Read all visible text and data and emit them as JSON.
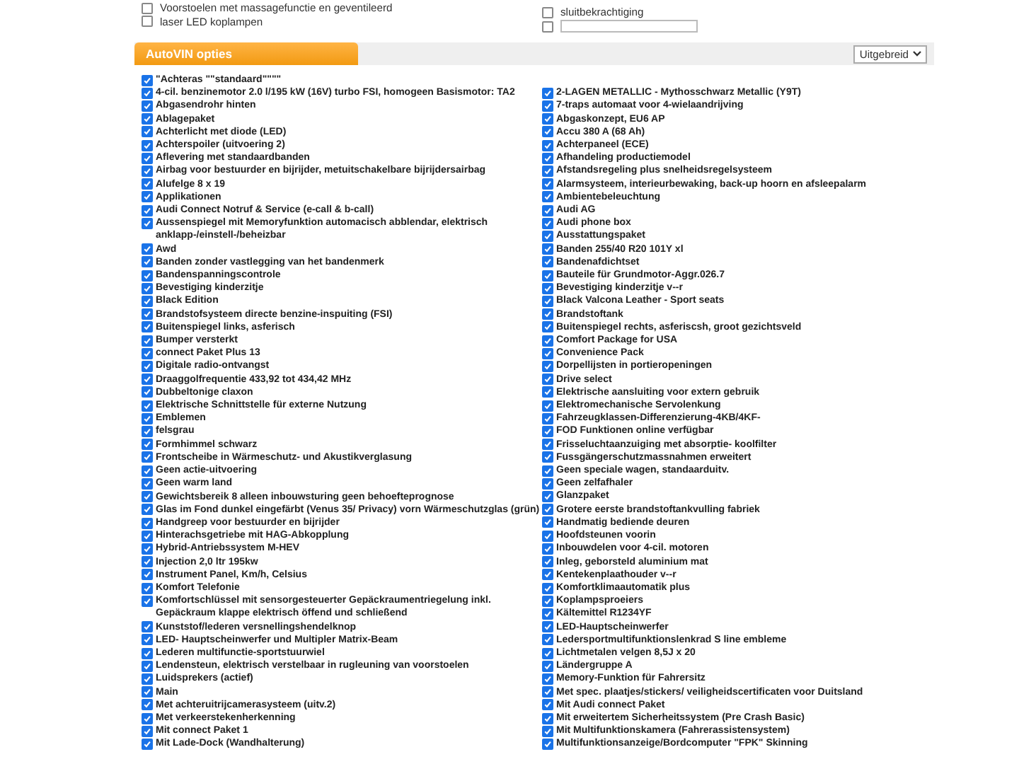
{
  "top_options": {
    "left": [
      {
        "label": "Voorstoelen met massagefunctie en geventileerd",
        "checked": false
      },
      {
        "label": "laser LED koplampen",
        "checked": false
      }
    ],
    "right": [
      {
        "label": "sluitbekrachtiging",
        "checked": false
      }
    ],
    "custom": {
      "checked": false
    }
  },
  "section": {
    "title": "AutoVIN opties",
    "view_select": "Uitgebreid"
  },
  "options_left": [
    {
      "label": "\"Achteras \"\"standaard\"\"\"\"",
      "checked": true
    },
    {
      "label": "4-cil. benzinemotor 2.0 l/195 kW (16V) turbo FSI, homogeen Basismotor: TA2",
      "checked": true
    },
    {
      "label": "Abgasendrohr hinten",
      "checked": true
    },
    {
      "label": "Ablagepaket",
      "checked": true
    },
    {
      "label": "Achterlicht met diode (LED)",
      "checked": true
    },
    {
      "label": "Achterspoiler (uitvoering 2)",
      "checked": true
    },
    {
      "label": "Aflevering met standaardbanden",
      "checked": true
    },
    {
      "label": "Airbag voor bestuurder en bijrijder, metuitschakelbare bijrijdersairbag",
      "checked": true
    },
    {
      "label": "Alufelge 8 x 19",
      "checked": true
    },
    {
      "label": "Applikationen",
      "checked": true
    },
    {
      "label": "Audi Connect Notruf & Service (e-call & b-call)",
      "checked": true
    },
    {
      "label": "Aussenspiegel mit Memoryfunktion automacisch abblendar, elektrisch anklapp-/einstell-/beheizbar",
      "checked": true
    },
    {
      "label": "Awd",
      "checked": true
    },
    {
      "label": "Banden zonder vastlegging van het bandenmerk",
      "checked": true
    },
    {
      "label": "Bandenspanningscontrole",
      "checked": true
    },
    {
      "label": "Bevestiging kinderzitje",
      "checked": true
    },
    {
      "label": "Black Edition",
      "checked": true
    },
    {
      "label": "Brandstofsysteem directe benzine-inspuiting (FSI)",
      "checked": true
    },
    {
      "label": "Buitenspiegel links, asferisch",
      "checked": true
    },
    {
      "label": "Bumper versterkt",
      "checked": true
    },
    {
      "label": "connect Paket Plus 13",
      "checked": true
    },
    {
      "label": "Digitale radio-ontvangst",
      "checked": true
    },
    {
      "label": "Draaggolfrequentie 433,92 tot 434,42 MHz",
      "checked": true
    },
    {
      "label": "Dubbeltonige claxon",
      "checked": true
    },
    {
      "label": "Elektrische Schnittstelle für externe Nutzung",
      "checked": true
    },
    {
      "label": "Emblemen",
      "checked": true
    },
    {
      "label": "felsgrau",
      "checked": true
    },
    {
      "label": "Formhimmel schwarz",
      "checked": true
    },
    {
      "label": "Frontscheibe in Wärmeschutz- und Akustikverglasung",
      "checked": true
    },
    {
      "label": "Geen actie-uitvoering",
      "checked": true
    },
    {
      "label": "Geen warm land",
      "checked": true
    },
    {
      "label": "Gewichtsbereik 8 alleen inbouwsturing geen behoefteprognose",
      "checked": true
    },
    {
      "label": "Glas im Fond dunkel eingefärbt (Venus 35/ Privacy) vorn Wärmeschutzglas (grün)",
      "checked": true
    },
    {
      "label": "Handgreep voor bestuurder en bijrijder",
      "checked": true
    },
    {
      "label": "Hinterachsgetriebe mit HAG-Abkopplung",
      "checked": true
    },
    {
      "label": "Hybrid-Antriebssystem M-HEV",
      "checked": true
    },
    {
      "label": "Injection 2,0 ltr 195kw",
      "checked": true
    },
    {
      "label": "Instrument Panel, Km/h, Celsius",
      "checked": true
    },
    {
      "label": "Komfort Telefonie",
      "checked": true
    },
    {
      "label": "Komfortschlüssel mit sensorgesteuerter Gepäckraumentriegelung inkl. Gepäckraum klappe elektrisch öffend und schließend",
      "checked": true
    },
    {
      "label": "Kunststof/lederen versnellingshendelknop",
      "checked": true
    },
    {
      "label": "LED- Hauptscheinwerfer und Multipler Matrix-Beam",
      "checked": true
    },
    {
      "label": "Lederen multifunctie-sportstuurwiel",
      "checked": true
    },
    {
      "label": "Lendensteun, elektrisch verstelbaar in rugleuning van voorstoelen",
      "checked": true
    },
    {
      "label": "Luidsprekers (actief)",
      "checked": true
    },
    {
      "label": "Main",
      "checked": true
    },
    {
      "label": "Met achteruitrijcamerasysteem (uitv.2)",
      "checked": true
    },
    {
      "label": "Met verkeerstekenherkenning",
      "checked": true
    },
    {
      "label": "Mit connect Paket 1",
      "checked": true
    },
    {
      "label": "Mit Lade-Dock (Wandhalterung)",
      "checked": true
    }
  ],
  "options_right": [
    {
      "label": "2-LAGEN METALLIC - Mythosschwarz Metallic (Y9T)",
      "checked": true
    },
    {
      "label": "7-traps automaat voor 4-wielaandrijving",
      "checked": true
    },
    {
      "label": "Abgaskonzept, EU6 AP",
      "checked": true
    },
    {
      "label": "Accu 380 A (68 Ah)",
      "checked": true
    },
    {
      "label": "Achterpaneel (ECE)",
      "checked": true
    },
    {
      "label": "Afhandeling productiemodel",
      "checked": true
    },
    {
      "label": "Afstandsregeling plus snelheidsregelsysteem",
      "checked": true
    },
    {
      "label": "Alarmsysteem, interieurbewaking, back-up hoorn en afsleepalarm",
      "checked": true
    },
    {
      "label": "Ambientebeleuchtung",
      "checked": true
    },
    {
      "label": "Audi AG",
      "checked": true
    },
    {
      "label": "Audi phone box",
      "checked": true
    },
    {
      "label": "Ausstattungspaket",
      "checked": true
    },
    {
      "label": "Banden 255/40 R20 101Y xl",
      "checked": true
    },
    {
      "label": "Bandenafdichtset",
      "checked": true
    },
    {
      "label": "Bauteile für Grundmotor-Aggr.026.7",
      "checked": true
    },
    {
      "label": "Bevestiging kinderzitje v--r",
      "checked": true
    },
    {
      "label": "Black Valcona Leather - Sport seats",
      "checked": true
    },
    {
      "label": "Brandstoftank",
      "checked": true
    },
    {
      "label": "Buitenspiegel rechts, asferiscsh, groot gezichtsveld",
      "checked": true
    },
    {
      "label": "Comfort Package for USA",
      "checked": true
    },
    {
      "label": "Convenience Pack",
      "checked": true
    },
    {
      "label": "Dorpellijsten in portieropeningen",
      "checked": true
    },
    {
      "label": "Drive select",
      "checked": true
    },
    {
      "label": "Elektrische aansluiting voor extern gebruik",
      "checked": true
    },
    {
      "label": "Elektromechanische Servolenkung",
      "checked": true
    },
    {
      "label": "Fahrzeugklassen-Differenzierung-4KB/4KF-",
      "checked": true
    },
    {
      "label": "FOD Funktionen online verfügbar",
      "checked": true
    },
    {
      "label": "Frisseluchtaanzuiging met absorptie- koolfilter",
      "checked": true
    },
    {
      "label": "Fussgängerschutzmassnahmen erweitert",
      "checked": true
    },
    {
      "label": "Geen speciale wagen, standaarduitv.",
      "checked": true
    },
    {
      "label": "Geen zelfafhaler",
      "checked": true
    },
    {
      "label": "Glanzpaket",
      "checked": true
    },
    {
      "label": "Grotere eerste brandstoftankvulling fabriek",
      "checked": true
    },
    {
      "label": "Handmatig bediende deuren",
      "checked": true
    },
    {
      "label": "Hoofdsteunen voorin",
      "checked": true
    },
    {
      "label": "Inbouwdelen voor 4-cil. motoren",
      "checked": true
    },
    {
      "label": "Inleg, geborsteld aluminium mat",
      "checked": true
    },
    {
      "label": "Kentekenplaathouder v--r",
      "checked": true
    },
    {
      "label": "Komfortklimaautomatik plus",
      "checked": true
    },
    {
      "label": "Koplampsproeiers",
      "checked": true
    },
    {
      "label": "Kältemittel R1234YF",
      "checked": true
    },
    {
      "label": "LED-Hauptscheinwerfer",
      "checked": true
    },
    {
      "label": "Ledersportmultifunktionslenkrad S line embleme",
      "checked": true
    },
    {
      "label": "Lichtmetalen velgen 8,5J x 20",
      "checked": true
    },
    {
      "label": "Ländergruppe A",
      "checked": true
    },
    {
      "label": "Memory-Funktion für Fahrersitz",
      "checked": true
    },
    {
      "label": "Met spec. plaatjes/stickers/ veiligheidscertificaten voor Duitsland",
      "checked": true
    },
    {
      "label": "Mit Audi connect Paket",
      "checked": true
    },
    {
      "label": "Mit erweitertem Sicherheitssystem (Pre Crash Basic)",
      "checked": true
    },
    {
      "label": "Mit Multifunktionskamera (Fahrerassistensystem)",
      "checked": true
    },
    {
      "label": "Multifunktionsanzeige/Bordcomputer \"FPK\" Skinning",
      "checked": true
    }
  ]
}
